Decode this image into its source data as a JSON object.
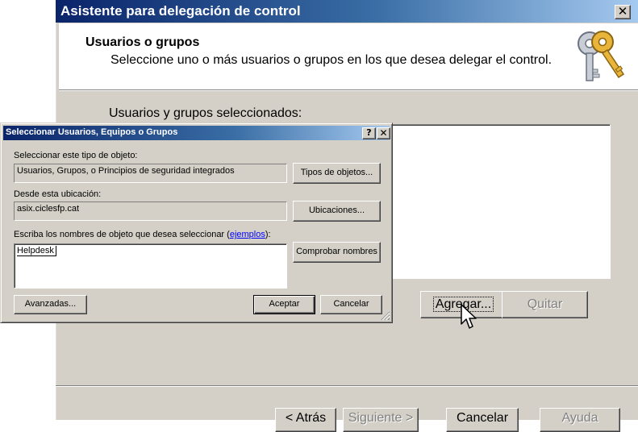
{
  "wizard": {
    "title": "Asistente para delegación de control",
    "close_glyph": "✕",
    "header_title": "Usuarios o grupos",
    "header_subtitle": "Seleccione uno o más usuarios o grupos en los que desea delegar el control.",
    "header_icon": "keys-icon",
    "selected_label": "Usuarios y grupos seleccionados:",
    "add_label": "Agregar...",
    "remove_label": "Quitar",
    "back_label": "< Atrás",
    "next_label": "Siguiente >",
    "cancel_label": "Cancelar",
    "help_label": "Ayuda"
  },
  "dialog": {
    "title": "Seleccionar Usuarios, Equipos o Grupos",
    "help_glyph": "?",
    "close_glyph": "✕",
    "object_type_label": "Seleccionar este tipo de objeto:",
    "object_type_value": "Usuarios, Grupos, o Principios de seguridad integrados",
    "object_types_button": "Tipos de objetos...",
    "location_label": "Desde esta ubicación:",
    "location_value": "asix.ciclesfp.cat",
    "locations_button": "Ubicaciones...",
    "names_label_pre": "Escriba los nombres de objeto que desea seleccionar (",
    "names_label_link": "ejemplos",
    "names_label_post": "):",
    "names_value": "Helpdesk",
    "check_names_button": "Comprobar nombres",
    "advanced_button": "Avanzadas...",
    "accept_button": "Aceptar",
    "cancel_button": "Cancelar"
  },
  "colors": {
    "titlebar_start": "#0a246a",
    "titlebar_end": "#a6caf0",
    "face": "#d4d0c8"
  }
}
